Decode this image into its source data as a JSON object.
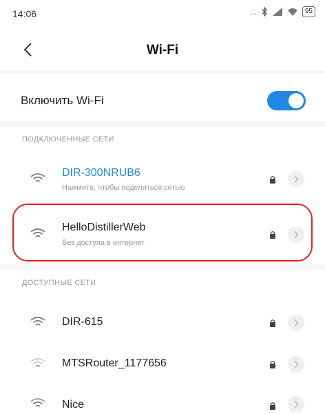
{
  "status_bar": {
    "time": "14:06",
    "battery": "95",
    "extra": "..."
  },
  "header": {
    "title": "Wi-Fi"
  },
  "wifi_toggle": {
    "label": "Включить Wi-Fi",
    "enabled": true
  },
  "sections": {
    "connected_header": "ПОДКЛЮЧЕННЫЕ СЕТИ",
    "available_header": "ДОСТУПНЫЕ СЕТИ"
  },
  "connected_networks": [
    {
      "name": "DIR-300NRUB6",
      "subtitle": "Нажмите, чтобы поделиться сетью",
      "secured": true
    },
    {
      "name": "HelloDistillerWeb",
      "subtitle": "Без доступа в интернет",
      "secured": true
    }
  ],
  "available_networks": [
    {
      "name": "DIR-615",
      "secured": true
    },
    {
      "name": "MTSRouter_1177656",
      "secured": true
    },
    {
      "name": "Nice",
      "secured": true
    }
  ],
  "colors": {
    "accent": "#1e88e5",
    "highlight": "#e02323"
  },
  "icons": [
    "back-arrow-icon",
    "wifi-icon",
    "lock-icon",
    "chevron-right-icon",
    "bluetooth-icon",
    "signal-icon",
    "battery-icon"
  ]
}
